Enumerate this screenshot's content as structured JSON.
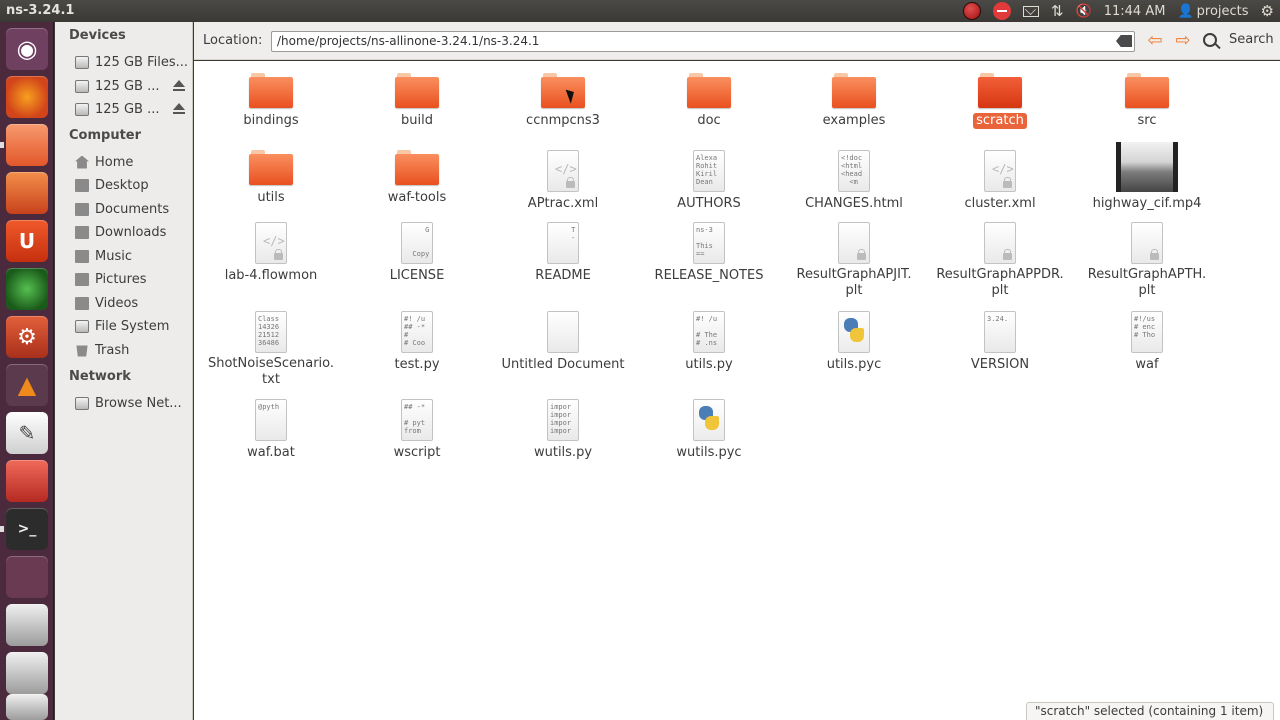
{
  "window": {
    "title": "ns-3.24.1"
  },
  "panel": {
    "clock": "11:44 AM",
    "user": "projects"
  },
  "sidebar": {
    "devices_heading": "Devices",
    "devices": [
      "125 GB Files...",
      "125 GB ...",
      "125 GB ..."
    ],
    "computer_heading": "Computer",
    "computer": [
      "Home",
      "Desktop",
      "Documents",
      "Downloads",
      "Music",
      "Pictures",
      "Videos",
      "File System",
      "Trash"
    ],
    "network_heading": "Network",
    "network": [
      "Browse Net..."
    ]
  },
  "toolbar": {
    "location_label": "Location:",
    "location_value": "/home/projects/ns-allinone-3.24.1/ns-3.24.1",
    "search_label": "Search"
  },
  "files": [
    {
      "name": "bindings",
      "type": "folder"
    },
    {
      "name": "build",
      "type": "folder"
    },
    {
      "name": "ccnmpcns3",
      "type": "folder"
    },
    {
      "name": "doc",
      "type": "folder"
    },
    {
      "name": "examples",
      "type": "folder"
    },
    {
      "name": "scratch",
      "type": "folder",
      "selected": true
    },
    {
      "name": "src",
      "type": "folder"
    },
    {
      "name": "utils",
      "type": "folder"
    },
    {
      "name": "waf-tools",
      "type": "folder"
    },
    {
      "name": "APtrac.xml",
      "type": "xml"
    },
    {
      "name": "AUTHORS",
      "type": "text",
      "preview": "Alexa\nRohit\nKiril\nDean"
    },
    {
      "name": "CHANGES.html",
      "type": "text",
      "preview": "<!doc\n<html\n<head\n  <m"
    },
    {
      "name": "cluster.xml",
      "type": "xml"
    },
    {
      "name": "highway_cif.mp4",
      "type": "video"
    },
    {
      "name": "lab-4.flowmon",
      "type": "xml"
    },
    {
      "name": "LICENSE",
      "type": "text",
      "preview": "     G\n\n\n  Copy"
    },
    {
      "name": "README",
      "type": "text",
      "preview": "     T\n     -"
    },
    {
      "name": "RELEASE_NOTES",
      "type": "text",
      "preview": "ns-3\n\nThis\n=="
    },
    {
      "name": "ResultGraphAPJIT.\nplt",
      "type": "locked"
    },
    {
      "name": "ResultGraphAPPDR.\nplt",
      "type": "locked"
    },
    {
      "name": "ResultGraphAPTH.\nplt",
      "type": "locked"
    },
    {
      "name": "ShotNoiseScenario.\ntxt",
      "type": "text",
      "preview": "Class\n14326\n21512\n36486"
    },
    {
      "name": "test.py",
      "type": "text",
      "preview": "#! /u\n## -*\n#\n# Coo"
    },
    {
      "name": "Untitled Document",
      "type": "blank"
    },
    {
      "name": "utils.py",
      "type": "text",
      "preview": "#! /u\n\n# The\n# .ns"
    },
    {
      "name": "utils.pyc",
      "type": "python"
    },
    {
      "name": "VERSION",
      "type": "text",
      "preview": "3.24."
    },
    {
      "name": "waf",
      "type": "text",
      "preview": "#!/us\n# enc\n# Tho"
    },
    {
      "name": "waf.bat",
      "type": "text",
      "preview": "@pyth"
    },
    {
      "name": "wscript",
      "type": "text",
      "preview": "## -*\n\n# pyt\nfrom"
    },
    {
      "name": "wutils.py",
      "type": "text",
      "preview": "impor\nimpor\nimpor\nimpor"
    },
    {
      "name": "wutils.pyc",
      "type": "python"
    }
  ],
  "status": "\"scratch\" selected (containing 1 item)"
}
